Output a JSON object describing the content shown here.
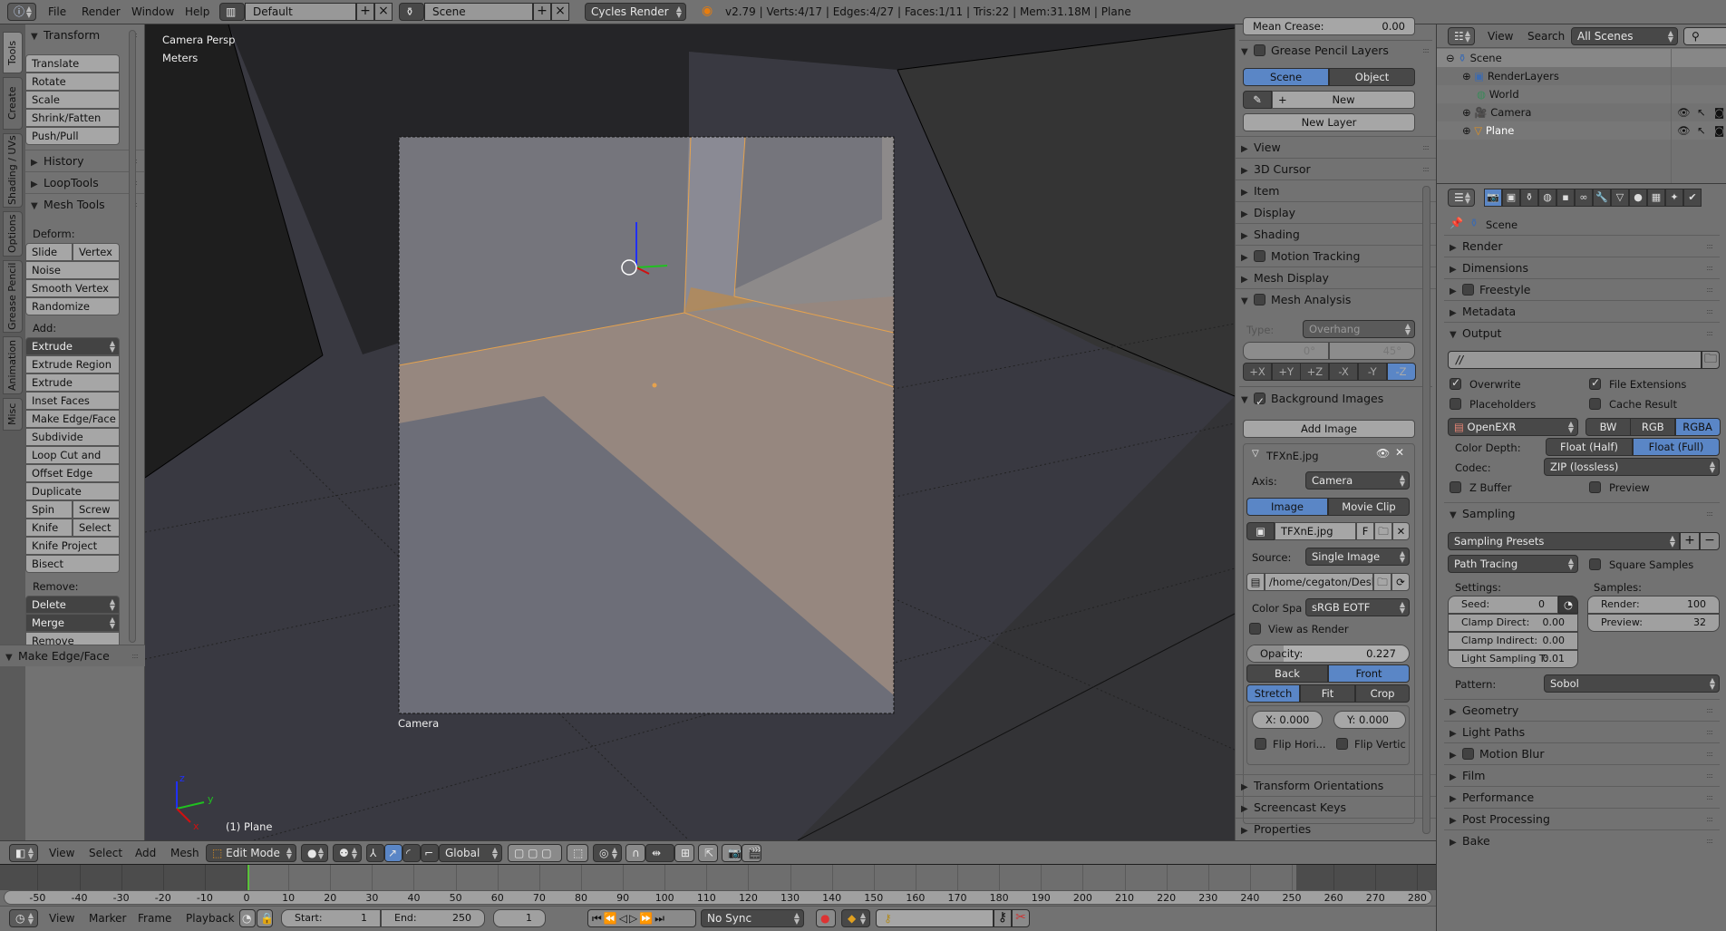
{
  "topbar": {
    "menus": [
      "File",
      "Render",
      "Window",
      "Help"
    ],
    "layout": "Default",
    "scene": "Scene",
    "engine": "Cycles Render",
    "status": "v2.79 | Verts:4/17 | Edges:4/27 | Faces:1/11 | Tris:22 | Mem:31.18M | Plane"
  },
  "tabs": [
    "Tools",
    "Create",
    "Shading / UVs",
    "Options",
    "Grease Pencil",
    "Animation",
    "Misc"
  ],
  "toolshelf": {
    "transform_title": "Transform",
    "transform_buttons": [
      "Translate",
      "Rotate",
      "Scale",
      "Shrink/Fatten",
      "Push/Pull"
    ],
    "history": "History",
    "looptools": "LoopTools",
    "meshtools": "Mesh Tools",
    "deform_label": "Deform:",
    "slide_edge": "Slide Ed",
    "vertex": "Vertex",
    "deform_buttons": [
      "Noise",
      "Smooth Vertex",
      "Randomize"
    ],
    "add_label": "Add:",
    "extrude": "Extrude",
    "add_buttons": [
      "Extrude Region",
      "Extrude Individual",
      "Inset Faces",
      "Make Edge/Face",
      "Subdivide",
      "Loop Cut and Slide",
      "Offset Edge Slide",
      "Duplicate"
    ],
    "spin": "Spin",
    "screw": "Screw",
    "knife": "Knife",
    "select": "Select",
    "knife_project": "Knife Project",
    "bisect": "Bisect",
    "remove_label": "Remove:",
    "delete": "Delete",
    "merge": "Merge",
    "remove_doubles": "Remove Doubles",
    "last_op": "Make Edge/Face"
  },
  "viewport": {
    "view_name": "Camera Persp",
    "units": "Meters",
    "camera_label": "Camera",
    "object_info": "(1) Plane",
    "axis_x": "x",
    "axis_y": "y",
    "axis_z": "z"
  },
  "npanel": {
    "mean_crease": "Mean Crease:",
    "mean_crease_val": "0.00",
    "grease_pencil_layers": "Grease Pencil Layers",
    "gp_scene": "Scene",
    "gp_object": "Object",
    "gp_new": "New",
    "gp_new_layer": "New Layer",
    "collapsed": [
      "View",
      "3D Cursor",
      "Item",
      "Display",
      "Shading"
    ],
    "motion_tracking": "Motion Tracking",
    "mesh_display": "Mesh Display",
    "mesh_analysis": "Mesh Analysis",
    "type_label": "Type:",
    "type_value": "Overhang",
    "angle_min": "0°",
    "angle_max": "45°",
    "axes": [
      "+X",
      "+Y",
      "+Z",
      "-X",
      "-Y",
      "-Z"
    ],
    "active_axis": "-Z",
    "background_images": "Background Images",
    "add_image": "Add Image",
    "bg_name": "TFXnE.jpg",
    "axis_label": "Axis:",
    "axis_value": "Camera",
    "image_tab": "Image",
    "movieclip_tab": "Movie Clip",
    "image_file": "TFXnE.jpg",
    "f_label": "F",
    "source_label": "Source:",
    "source_value": "Single Image",
    "path": "/home/cegaton/Desk...",
    "colorspace_label": "Color Spa",
    "colorspace_value": "sRGB EOTF",
    "view_as_render": "View as Render",
    "opacity_label": "Opacity:",
    "opacity_value": "0.227",
    "back": "Back",
    "front": "Front",
    "stretch": "Stretch",
    "fit": "Fit",
    "crop": "Crop",
    "x_label": "X:",
    "x_value": "0.000",
    "y_label": "Y:",
    "y_value": "0.000",
    "flip_h": "Flip Hori...",
    "flip_v": "Flip Vertic",
    "bottom_panels": [
      "Transform Orientations",
      "Screencast Keys",
      "Properties"
    ]
  },
  "outliner": {
    "view": "View",
    "search": "Search",
    "filter": "All Scenes",
    "items": [
      {
        "name": "Scene"
      },
      {
        "name": "RenderLayers"
      },
      {
        "name": "World"
      },
      {
        "name": "Camera"
      },
      {
        "name": "Plane"
      }
    ]
  },
  "properties": {
    "context": "Scene",
    "collapsed_top": [
      "Render",
      "Dimensions"
    ],
    "freestyle": "Freestyle",
    "metadata": "Metadata",
    "output": "Output",
    "output_path": "//",
    "overwrite": "Overwrite",
    "file_extensions": "File Extensions",
    "placeholders": "Placeholders",
    "cache_result": "Cache Result",
    "format": "OpenEXR",
    "color_modes": [
      "BW",
      "RGB",
      "RGBA"
    ],
    "color_mode_active": "RGBA",
    "color_depth_label": "Color Depth:",
    "depths": [
      "Float (Half)",
      "Float (Full)"
    ],
    "depth_active": "Float (Full)",
    "codec_label": "Codec:",
    "codec_value": "ZIP (lossless)",
    "z_buffer": "Z Buffer",
    "preview": "Preview",
    "sampling": "Sampling",
    "sampling_presets": "Sampling Presets",
    "integrator": "Path Tracing",
    "square_samples": "Square Samples",
    "settings_label": "Settings:",
    "samples_label": "Samples:",
    "seed_label": "Seed:",
    "seed_value": "0",
    "clamp_direct_label": "Clamp Direct:",
    "clamp_direct_value": "0.00",
    "clamp_indirect_label": "Clamp Indirect:",
    "clamp_indirect_value": "0.00",
    "light_sampling_label": "Light Sampling T:",
    "light_sampling_value": "0.01",
    "render_label": "Render:",
    "render_value": "100",
    "preview_label": "Preview:",
    "preview_value": "32",
    "pattern_label": "Pattern:",
    "pattern_value": "Sobol",
    "bottom_panels": [
      "Geometry",
      "Light Paths"
    ],
    "motion_blur": "Motion Blur",
    "bottom_panels2": [
      "Film",
      "Performance",
      "Post Processing",
      "Bake"
    ]
  },
  "vpheader": {
    "menus": [
      "View",
      "Select",
      "Add",
      "Mesh"
    ],
    "mode": "Edit Mode",
    "orientation": "Global"
  },
  "timeline": {
    "ticks": [
      "-50",
      "-40",
      "-30",
      "-20",
      "-10",
      "0",
      "10",
      "20",
      "30",
      "40",
      "50",
      "60",
      "70",
      "80",
      "90",
      "100",
      "110",
      "120",
      "130",
      "140",
      "150",
      "160",
      "170",
      "180",
      "190",
      "200",
      "210",
      "220",
      "230",
      "240",
      "250",
      "260",
      "270",
      "280"
    ],
    "menus": [
      "View",
      "Marker",
      "Frame",
      "Playback"
    ],
    "start_label": "Start:",
    "start_value": "1",
    "end_label": "End:",
    "end_value": "250",
    "current_frame": "1",
    "sync": "No Sync"
  }
}
